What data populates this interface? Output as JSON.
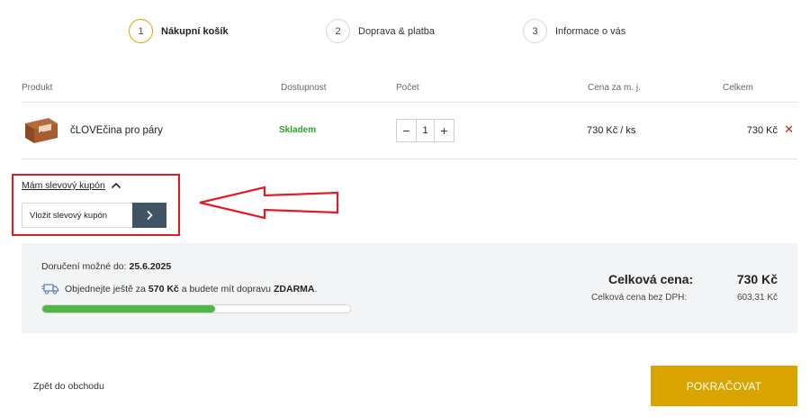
{
  "steps": [
    {
      "number": "1",
      "label": "Nákupní košík"
    },
    {
      "number": "2",
      "label": "Doprava & platba"
    },
    {
      "number": "3",
      "label": "Informace o vás"
    }
  ],
  "table": {
    "headers": [
      "Produkt",
      "Dostupnost",
      "Počet",
      "Cena za m. j.",
      "Celkem"
    ],
    "item": {
      "name": "čLOVEčina pro páry",
      "availability": "Skladem",
      "quantity": "1",
      "minus": "−",
      "plus": "+",
      "unit_price": "730 Kč / ks",
      "total": "730 Kč",
      "remove": "✕"
    }
  },
  "coupon": {
    "toggle_label": "Mám slevový kupón",
    "input_placeholder": "Vložit slevový kupón"
  },
  "summary": {
    "delivery_label": "Doručení možné do:",
    "delivery_date": "25.6.2025",
    "free_shipping_pre": "Objednejte ještě za",
    "free_shipping_amount": "570 Kč",
    "free_shipping_mid": "a budete mít dopravu",
    "free_shipping_free": "ZDARMA",
    "free_shipping_post": ".",
    "progress_fraction": 0.56,
    "total_label": "Celková cena:",
    "total_value": "730 Kč",
    "vat_label": "Celková cena bez DPH:",
    "vat_value": "603,31 Kč"
  },
  "footer": {
    "back_label": "Zpět do obchodu",
    "continue_label": "POKRAČOVAT"
  },
  "colors": {
    "accent": "#d9a400",
    "progress": "#4cb944",
    "in_stock": "#2aa52a",
    "highlight": "#e11b22",
    "coupon_button": "#3f5566"
  }
}
